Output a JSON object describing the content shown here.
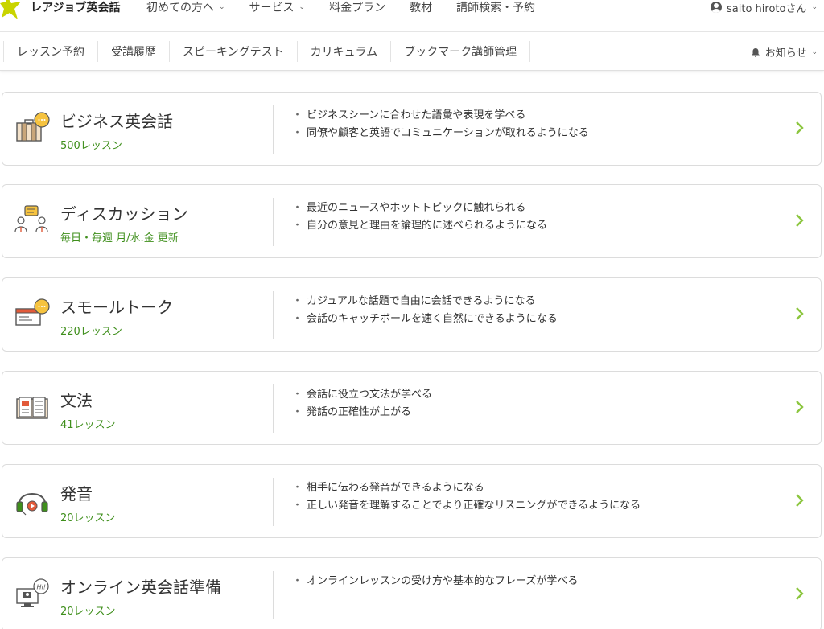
{
  "colors": {
    "accent_green": "#3f8f1c",
    "chevron_green": "#8cc63f",
    "star_yellow": "#c9d400"
  },
  "logo": {
    "text": "レアジョブ英会話"
  },
  "topnav": {
    "items": [
      {
        "label": "初めての方へ",
        "has_caret": true
      },
      {
        "label": "サービス",
        "has_caret": true
      },
      {
        "label": "料金プラン",
        "has_caret": false
      },
      {
        "label": "教材",
        "has_caret": false
      },
      {
        "label": "講師検索・予約",
        "has_caret": false
      }
    ],
    "user_name": "saito hirotoさん",
    "user_icon": "user-circle-icon"
  },
  "subnav": {
    "items": [
      "レッスン予約",
      "受講履歴",
      "スピーキングテスト",
      "カリキュラム",
      "ブックマーク講師管理"
    ],
    "notice_label": "お知らせ",
    "notice_icon": "bell-icon"
  },
  "courses": [
    {
      "title": "ビジネス英会話",
      "sub": "500レッスン",
      "icon": "briefcase-chat-icon",
      "bullets": [
        "ビジネスシーンに合わせた語彙や表現を学べる",
        "同僚や顧客と英語でコミュニケーションが取れるようになる"
      ]
    },
    {
      "title": "ディスカッション",
      "sub": "毎日・毎週 月/水.金 更新",
      "icon": "discussion-people-icon",
      "bullets": [
        "最近のニュースやホットトピックに触れられる",
        "自分の意見と理由を論理的に述べられるようになる"
      ]
    },
    {
      "title": "スモールトーク",
      "sub": "220レッスン",
      "icon": "small-talk-chat-icon",
      "bullets": [
        "カジュアルな話題で自由に会話できるようになる",
        "会話のキャッチボールを速く自然にできるようになる"
      ]
    },
    {
      "title": "文法",
      "sub": "41レッスン",
      "icon": "open-book-icon",
      "bullets": [
        "会話に役立つ文法が学べる",
        "発話の正確性が上がる"
      ]
    },
    {
      "title": "発音",
      "sub": "20レッスン",
      "icon": "headphones-icon",
      "bullets": [
        "相手に伝わる発音ができるようになる",
        "正しい発音を理解することでより正確なリスニングができるようになる"
      ]
    },
    {
      "title": "オンライン英会話準備",
      "sub": "20レッスン",
      "icon": "monitor-hi-icon",
      "bullets": [
        "オンラインレッスンの受け方や基本的なフレーズが学べる"
      ]
    }
  ]
}
